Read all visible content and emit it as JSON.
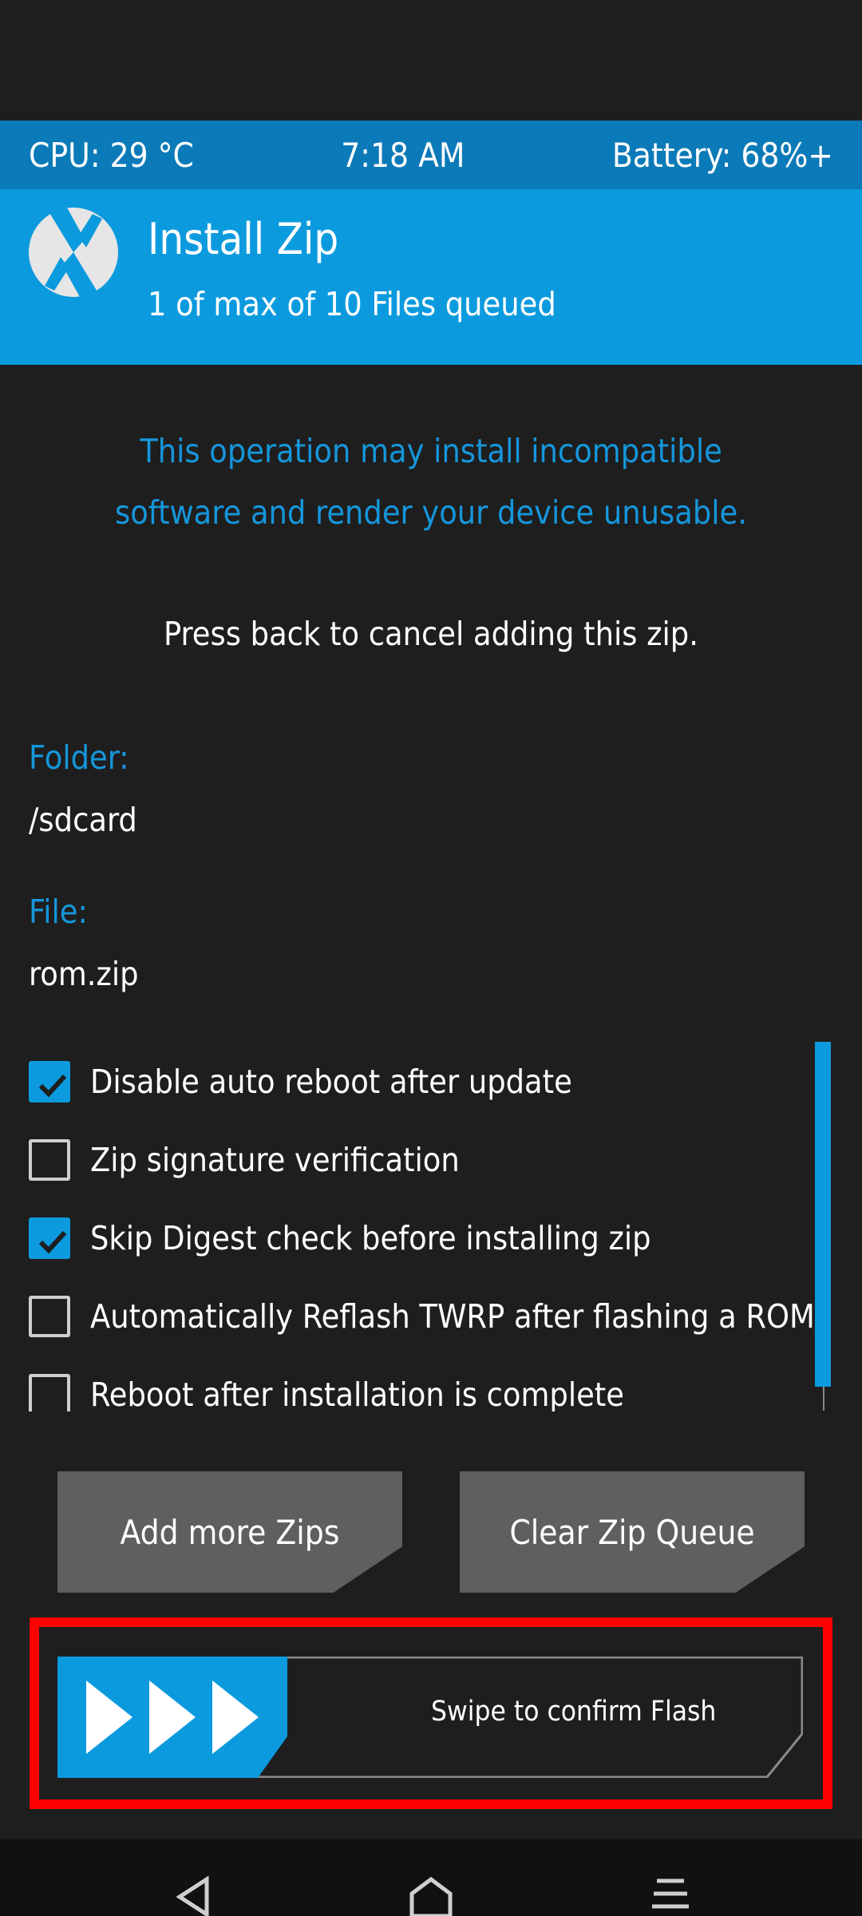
{
  "status": {
    "cpu": "CPU: 29 °C",
    "time": "7:18 AM",
    "battery": "Battery: 68%+"
  },
  "header": {
    "title": "Install Zip",
    "subtitle": "1 of max of 10 Files queued",
    "logo_icon": "twrp-logo-icon"
  },
  "warning": {
    "line1": "This operation may install incompatible",
    "line2": "software and render your device unusable."
  },
  "note": "Press back to cancel adding this zip.",
  "folder": {
    "label": "Folder:",
    "value": "/sdcard"
  },
  "file": {
    "label": "File:",
    "value": "rom.zip"
  },
  "options": [
    {
      "label": "Disable auto reboot after update",
      "checked": true
    },
    {
      "label": "Zip signature verification",
      "checked": false
    },
    {
      "label": "Skip Digest check before installing zip",
      "checked": true
    },
    {
      "label": "Automatically Reflash TWRP after flashing a ROM",
      "checked": false
    },
    {
      "label": "Reboot after installation is complete",
      "checked": false
    }
  ],
  "buttons": {
    "add_more": "Add more Zips",
    "clear_queue": "Clear Zip Queue"
  },
  "swipe": {
    "label": "Swipe to confirm Flash",
    "handle_icon": "triple-arrow-right-icon"
  },
  "colors": {
    "accent": "#0b9ade",
    "status_bar": "#0b7ab8",
    "background": "#1e1e1e",
    "warning_text": "#1596db",
    "button": "#5f5f5f",
    "highlight": "#ff0000"
  }
}
